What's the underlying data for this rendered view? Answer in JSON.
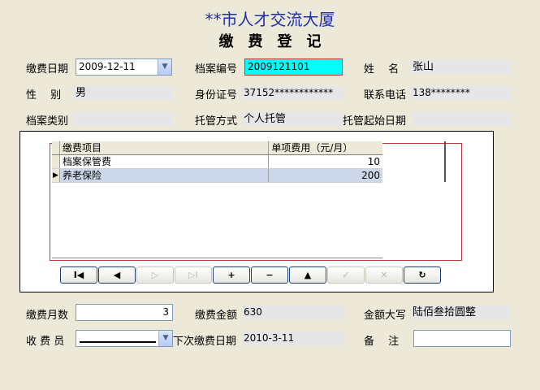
{
  "header": {
    "org_title": "**市人才交流大厦",
    "form_title": "缴费登记"
  },
  "fields": {
    "pay_date": {
      "label": "缴费日期",
      "value": "2009-12-11"
    },
    "file_no": {
      "label": "档案编号",
      "value": "2009121101"
    },
    "name": {
      "label": "姓　 名",
      "value": "张山"
    },
    "gender": {
      "label": "性　 别",
      "value": "男"
    },
    "id_no": {
      "label": "身份证号",
      "value": "37152************"
    },
    "phone": {
      "label": "联系电话",
      "value": "138********"
    },
    "file_type": {
      "label": "档案类别",
      "value": ""
    },
    "custody_mode": {
      "label": "托管方式",
      "value": "个人托管"
    },
    "custody_start": {
      "label": "托管起始日期",
      "value": ""
    },
    "months": {
      "label": "缴费月数",
      "value": "3"
    },
    "amount": {
      "label": "缴费金额",
      "value": "630"
    },
    "amount_upper": {
      "label": "金额大写",
      "value": "陆佰叁拾圆整"
    },
    "collector": {
      "label": "收 费 员",
      "value": ""
    },
    "next_date": {
      "label": "下次缴费日期",
      "value": "2010-3-11"
    },
    "remark": {
      "label": "备　 注",
      "value": ""
    }
  },
  "grid": {
    "headers": [
      "缴费项目",
      "单项费用（元/月）"
    ],
    "rows": [
      {
        "item": "档案保管费",
        "fee": "10"
      },
      {
        "item": "养老保险",
        "fee": "200"
      }
    ]
  },
  "navigator": [
    {
      "name": "first",
      "icon": "first-record-icon",
      "glyph": "I◀",
      "enabled": true
    },
    {
      "name": "prior",
      "icon": "prior-record-icon",
      "glyph": "◀",
      "enabled": true
    },
    {
      "name": "next",
      "icon": "next-record-icon",
      "glyph": "▷",
      "enabled": false
    },
    {
      "name": "last",
      "icon": "last-record-icon",
      "glyph": "▷I",
      "enabled": false
    },
    {
      "name": "insert",
      "icon": "plus-icon",
      "glyph": "+",
      "enabled": true
    },
    {
      "name": "delete",
      "icon": "minus-icon",
      "glyph": "−",
      "enabled": true
    },
    {
      "name": "edit",
      "icon": "up-arrow-icon",
      "glyph": "▲",
      "enabled": true
    },
    {
      "name": "post",
      "icon": "check-icon",
      "glyph": "✓",
      "enabled": false
    },
    {
      "name": "cancel",
      "icon": "cross-icon",
      "glyph": "✕",
      "enabled": false
    },
    {
      "name": "refresh",
      "icon": "refresh-icon",
      "glyph": "↻",
      "enabled": true
    }
  ],
  "colors": {
    "title": "#1f2fa8",
    "highlight_input": "#00ffff",
    "selected_row": "#cdd7ea"
  }
}
